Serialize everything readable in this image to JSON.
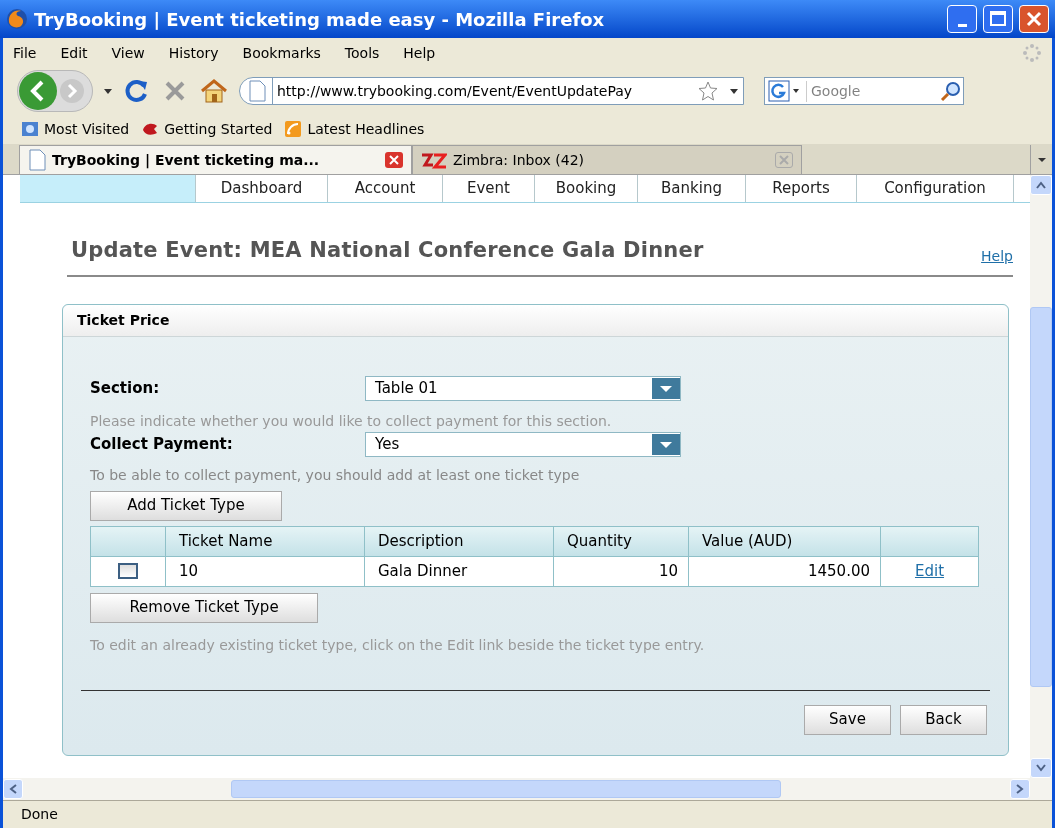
{
  "window": {
    "title": "TryBooking | Event ticketing made easy - Mozilla Firefox"
  },
  "menu": [
    "File",
    "Edit",
    "View",
    "History",
    "Bookmarks",
    "Tools",
    "Help"
  ],
  "address": {
    "url": "http://www.trybooking.com/Event/EventUpdatePay"
  },
  "search": {
    "placeholder": "Google"
  },
  "bookmarks": [
    "Most Visited",
    "Getting Started",
    "Latest Headlines"
  ],
  "tabs": [
    {
      "label": "TryBooking | Event ticketing ma...",
      "selected": true
    },
    {
      "label": "Zimbra: Inbox (42)",
      "selected": false
    }
  ],
  "site_nav": [
    "Dashboard",
    "Account",
    "Event",
    "Booking",
    "Banking",
    "Reports",
    "Configuration"
  ],
  "page": {
    "title": "Update Event: MEA National Conference Gala Dinner",
    "help": "Help"
  },
  "panel": {
    "title": "Ticket Price",
    "section": {
      "label": "Section:",
      "value": "Table 01"
    },
    "payment_hint": "Please indicate whether you would like to collect payment for this section.",
    "collect_payment": {
      "label": "Collect Payment:",
      "value": "Yes"
    },
    "ticket_hint": "To be able to collect payment, you should add at least one ticket type",
    "add_button": "Add Ticket Type",
    "table": {
      "columns": [
        "Ticket Name",
        "Description",
        "Quantity",
        "Value (AUD)"
      ],
      "rows": [
        {
          "checked": false,
          "name": "10",
          "description": "Gala Dinner",
          "quantity": "10",
          "value": "1450.00",
          "action": "Edit"
        }
      ]
    },
    "remove_button": "Remove Ticket Type",
    "edit_hint": "To edit an already existing ticket type, click on the Edit link beside the ticket type entry.",
    "buttons": [
      "Save",
      "Back"
    ]
  },
  "status_bar": "Done"
}
